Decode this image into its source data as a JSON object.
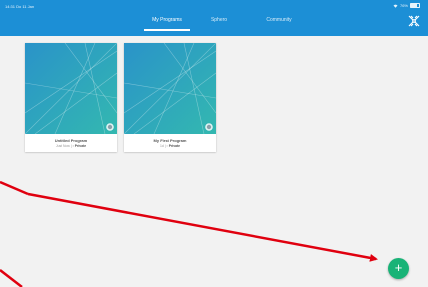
{
  "status_bar": {
    "time": "14:31  Do 11 Jan",
    "battery": "76%",
    "battery_level": 0.76,
    "wifi_icon": "wifi-icon",
    "battery_icon": "battery-icon"
  },
  "tabs": [
    {
      "label": "My Programs",
      "active": true
    },
    {
      "label": "Sphero",
      "active": false
    },
    {
      "label": "Community",
      "active": false
    }
  ],
  "logo_icon": "sphero-logo-icon",
  "programs": [
    {
      "title": "Untitled Program",
      "meta_prefix": "Just Now |",
      "meta_label": "Private",
      "badge_icon": "robot-badge-icon"
    },
    {
      "title": "My First Program",
      "meta_prefix": "1d |",
      "meta_label": "Private",
      "badge_icon": "robot-badge-icon"
    }
  ],
  "fab": {
    "label": "+",
    "icon": "add-icon"
  },
  "colors": {
    "header": "#1c8fd6",
    "background": "#f2f2f2",
    "thumb_from": "#2a93c9",
    "thumb_to": "#33b8b0",
    "fab": "#19b377",
    "annotation_arrow": "#e0000f"
  }
}
